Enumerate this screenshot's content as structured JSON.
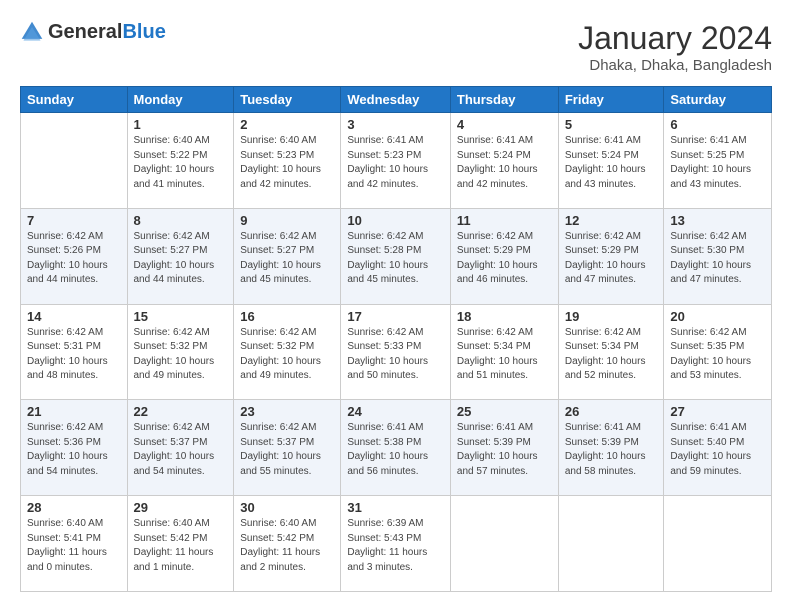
{
  "header": {
    "logo_general": "General",
    "logo_blue": "Blue",
    "month_year": "January 2024",
    "location": "Dhaka, Dhaka, Bangladesh"
  },
  "weekdays": [
    "Sunday",
    "Monday",
    "Tuesday",
    "Wednesday",
    "Thursday",
    "Friday",
    "Saturday"
  ],
  "weeks": [
    [
      {
        "day": "",
        "info": ""
      },
      {
        "day": "1",
        "info": "Sunrise: 6:40 AM\nSunset: 5:22 PM\nDaylight: 10 hours\nand 41 minutes."
      },
      {
        "day": "2",
        "info": "Sunrise: 6:40 AM\nSunset: 5:23 PM\nDaylight: 10 hours\nand 42 minutes."
      },
      {
        "day": "3",
        "info": "Sunrise: 6:41 AM\nSunset: 5:23 PM\nDaylight: 10 hours\nand 42 minutes."
      },
      {
        "day": "4",
        "info": "Sunrise: 6:41 AM\nSunset: 5:24 PM\nDaylight: 10 hours\nand 42 minutes."
      },
      {
        "day": "5",
        "info": "Sunrise: 6:41 AM\nSunset: 5:24 PM\nDaylight: 10 hours\nand 43 minutes."
      },
      {
        "day": "6",
        "info": "Sunrise: 6:41 AM\nSunset: 5:25 PM\nDaylight: 10 hours\nand 43 minutes."
      }
    ],
    [
      {
        "day": "7",
        "info": "Sunrise: 6:42 AM\nSunset: 5:26 PM\nDaylight: 10 hours\nand 44 minutes."
      },
      {
        "day": "8",
        "info": "Sunrise: 6:42 AM\nSunset: 5:27 PM\nDaylight: 10 hours\nand 44 minutes."
      },
      {
        "day": "9",
        "info": "Sunrise: 6:42 AM\nSunset: 5:27 PM\nDaylight: 10 hours\nand 45 minutes."
      },
      {
        "day": "10",
        "info": "Sunrise: 6:42 AM\nSunset: 5:28 PM\nDaylight: 10 hours\nand 45 minutes."
      },
      {
        "day": "11",
        "info": "Sunrise: 6:42 AM\nSunset: 5:29 PM\nDaylight: 10 hours\nand 46 minutes."
      },
      {
        "day": "12",
        "info": "Sunrise: 6:42 AM\nSunset: 5:29 PM\nDaylight: 10 hours\nand 47 minutes."
      },
      {
        "day": "13",
        "info": "Sunrise: 6:42 AM\nSunset: 5:30 PM\nDaylight: 10 hours\nand 47 minutes."
      }
    ],
    [
      {
        "day": "14",
        "info": "Sunrise: 6:42 AM\nSunset: 5:31 PM\nDaylight: 10 hours\nand 48 minutes."
      },
      {
        "day": "15",
        "info": "Sunrise: 6:42 AM\nSunset: 5:32 PM\nDaylight: 10 hours\nand 49 minutes."
      },
      {
        "day": "16",
        "info": "Sunrise: 6:42 AM\nSunset: 5:32 PM\nDaylight: 10 hours\nand 49 minutes."
      },
      {
        "day": "17",
        "info": "Sunrise: 6:42 AM\nSunset: 5:33 PM\nDaylight: 10 hours\nand 50 minutes."
      },
      {
        "day": "18",
        "info": "Sunrise: 6:42 AM\nSunset: 5:34 PM\nDaylight: 10 hours\nand 51 minutes."
      },
      {
        "day": "19",
        "info": "Sunrise: 6:42 AM\nSunset: 5:34 PM\nDaylight: 10 hours\nand 52 minutes."
      },
      {
        "day": "20",
        "info": "Sunrise: 6:42 AM\nSunset: 5:35 PM\nDaylight: 10 hours\nand 53 minutes."
      }
    ],
    [
      {
        "day": "21",
        "info": "Sunrise: 6:42 AM\nSunset: 5:36 PM\nDaylight: 10 hours\nand 54 minutes."
      },
      {
        "day": "22",
        "info": "Sunrise: 6:42 AM\nSunset: 5:37 PM\nDaylight: 10 hours\nand 54 minutes."
      },
      {
        "day": "23",
        "info": "Sunrise: 6:42 AM\nSunset: 5:37 PM\nDaylight: 10 hours\nand 55 minutes."
      },
      {
        "day": "24",
        "info": "Sunrise: 6:41 AM\nSunset: 5:38 PM\nDaylight: 10 hours\nand 56 minutes."
      },
      {
        "day": "25",
        "info": "Sunrise: 6:41 AM\nSunset: 5:39 PM\nDaylight: 10 hours\nand 57 minutes."
      },
      {
        "day": "26",
        "info": "Sunrise: 6:41 AM\nSunset: 5:39 PM\nDaylight: 10 hours\nand 58 minutes."
      },
      {
        "day": "27",
        "info": "Sunrise: 6:41 AM\nSunset: 5:40 PM\nDaylight: 10 hours\nand 59 minutes."
      }
    ],
    [
      {
        "day": "28",
        "info": "Sunrise: 6:40 AM\nSunset: 5:41 PM\nDaylight: 11 hours\nand 0 minutes."
      },
      {
        "day": "29",
        "info": "Sunrise: 6:40 AM\nSunset: 5:42 PM\nDaylight: 11 hours\nand 1 minute."
      },
      {
        "day": "30",
        "info": "Sunrise: 6:40 AM\nSunset: 5:42 PM\nDaylight: 11 hours\nand 2 minutes."
      },
      {
        "day": "31",
        "info": "Sunrise: 6:39 AM\nSunset: 5:43 PM\nDaylight: 11 hours\nand 3 minutes."
      },
      {
        "day": "",
        "info": ""
      },
      {
        "day": "",
        "info": ""
      },
      {
        "day": "",
        "info": ""
      }
    ]
  ]
}
